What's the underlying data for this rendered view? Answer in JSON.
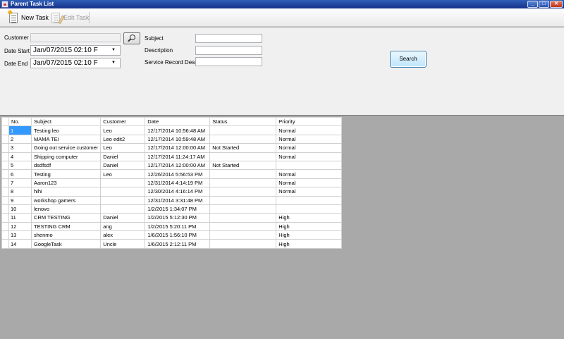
{
  "window": {
    "title": "Parent Task List",
    "controls": [
      "_",
      "□",
      "✕"
    ]
  },
  "toolbar": {
    "new_task": "New Task",
    "edit_task": "Edit Task"
  },
  "form": {
    "customer_label": "Customer",
    "customer_value": "",
    "date_start_label": "Date Start",
    "date_start_value": "Jan/07/2015 02:10 F",
    "date_end_label": "Date End",
    "date_end_value": "Jan/07/2015 02:10 F",
    "subject_label": "Subject",
    "subject_value": "",
    "description_label": "Description",
    "description_value": "",
    "service_record_label": "Service Record Desc",
    "service_record_value": "",
    "search_button": "Search"
  },
  "grid": {
    "columns": [
      "No.",
      "Subject",
      "Customer",
      "Date",
      "Status",
      "Priority"
    ],
    "rows": [
      [
        "1",
        "Testing leo",
        "Leo",
        "12/17/2014 10:56:48 AM",
        "",
        "Normal"
      ],
      [
        "2",
        "MAMA TEI",
        "Leo edit2",
        "12/17/2014 10:59:48 AM",
        "",
        "Normal"
      ],
      [
        "3",
        "Going out service customer",
        "Leo",
        "12/17/2014 12:00:00 AM",
        "Not Started",
        "Normal"
      ],
      [
        "4",
        "Shipping computer",
        "Daniel",
        "12/17/2014 11:24:17 AM",
        "",
        "Normal"
      ],
      [
        "5",
        "dsdfsdf",
        "Daniel",
        "12/17/2014 12:00:00 AM",
        "Not Started",
        ""
      ],
      [
        "6",
        "Testing",
        "Leo",
        "12/26/2014 5:56:53 PM",
        "",
        "Normal"
      ],
      [
        "7",
        "Aaron123",
        "",
        "12/31/2014 4:14:19 PM",
        "",
        "Normal"
      ],
      [
        "8",
        "hihi",
        "",
        "12/30/2014 4:16:14 PM",
        "",
        "Normal"
      ],
      [
        "9",
        "workshop gamers",
        "",
        "12/31/2014 3:31:48 PM",
        "",
        ""
      ],
      [
        "10",
        "lenovo",
        "",
        "1/2/2015 1:34:07 PM",
        "",
        ""
      ],
      [
        "11",
        "CRM TESTING",
        "Daniel",
        "1/2/2015 5:12:30 PM",
        "",
        "High"
      ],
      [
        "12",
        "TESTING CRM",
        "ang",
        "1/2/2015 5:20:11 PM",
        "",
        "High"
      ],
      [
        "13",
        "shenmo",
        "alex",
        "1/6/2015 1:56:10 PM",
        "",
        "High"
      ],
      [
        "14",
        "GoogleTask",
        "Uncle",
        "1/6/2015 2:12:11 PM",
        "",
        "High"
      ]
    ],
    "selected_row": 0
  },
  "colors": {
    "selection": "#3399ff",
    "titlebar": "#2f5fb8",
    "grid_background": "#a9a9a9"
  }
}
